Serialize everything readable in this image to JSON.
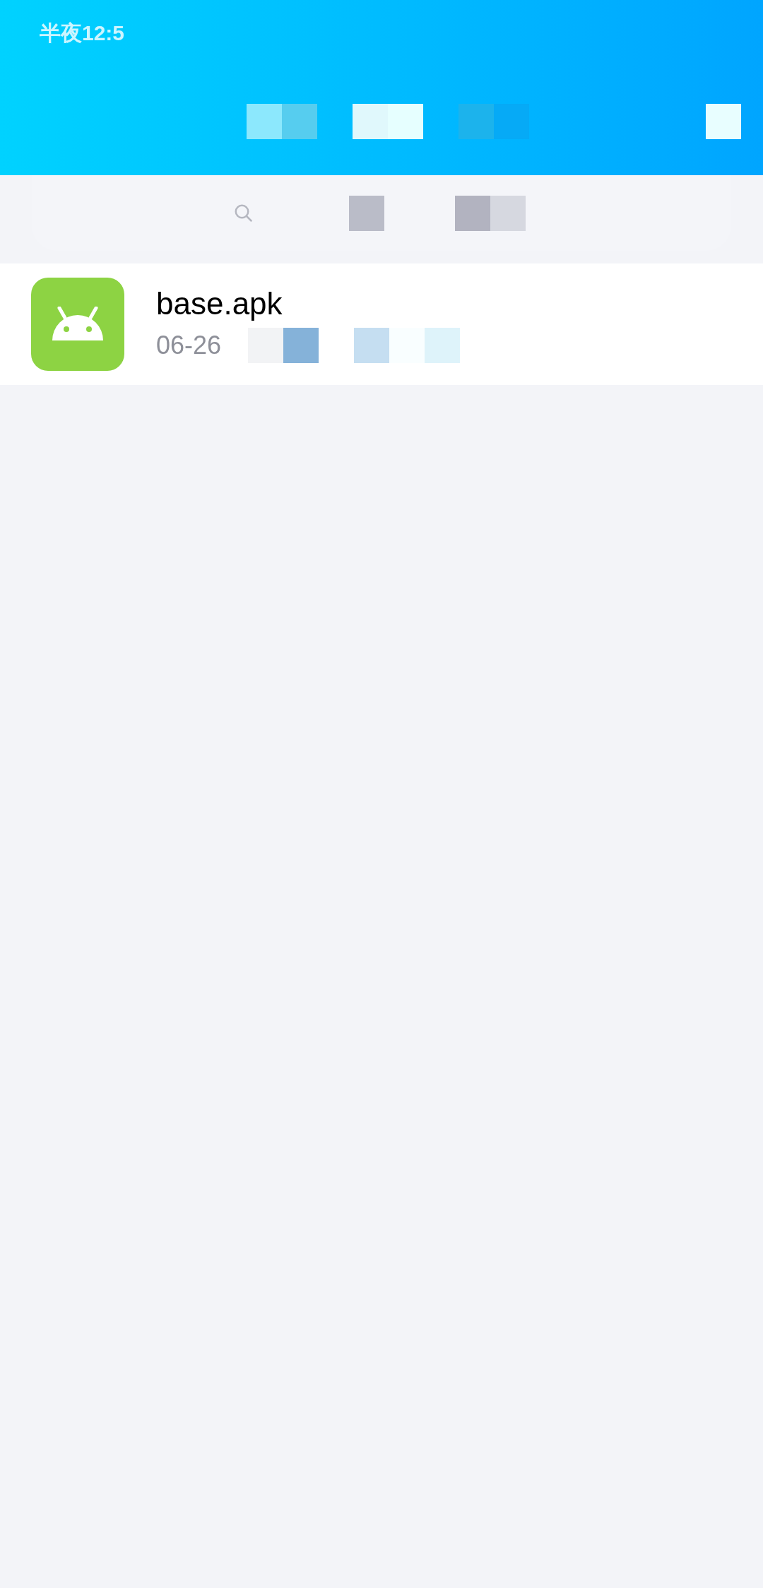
{
  "status_bar": {
    "time": "半夜12:5"
  },
  "files": [
    {
      "name": "base.apk",
      "date": "06-26"
    }
  ]
}
